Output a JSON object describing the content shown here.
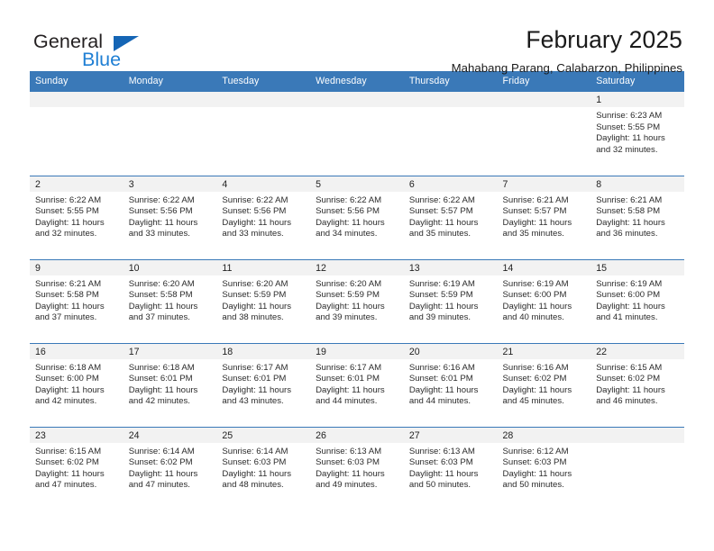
{
  "brand": {
    "name_part1": "General",
    "name_part2": "Blue",
    "triangle_icon": "triangle-icon",
    "color_dark": "#231f20",
    "color_blue": "#1f7fd4"
  },
  "header": {
    "title": "February 2025",
    "subtitle": "Mahabang Parang, Calabarzon, Philippines"
  },
  "theme": {
    "header_bg": "#3a79b8",
    "header_text": "#ffffff",
    "daynum_band_bg": "#f2f2f2",
    "row_divider": "#3a79b8"
  },
  "calendar": {
    "weekdays": [
      "Sunday",
      "Monday",
      "Tuesday",
      "Wednesday",
      "Thursday",
      "Friday",
      "Saturday"
    ],
    "weeks": [
      [
        {
          "day": "",
          "empty": true
        },
        {
          "day": "",
          "empty": true
        },
        {
          "day": "",
          "empty": true
        },
        {
          "day": "",
          "empty": true
        },
        {
          "day": "",
          "empty": true
        },
        {
          "day": "",
          "empty": true
        },
        {
          "day": "1",
          "sunrise": "Sunrise: 6:23 AM",
          "sunset": "Sunset: 5:55 PM",
          "daylight1": "Daylight: 11 hours",
          "daylight2": "and 32 minutes."
        }
      ],
      [
        {
          "day": "2",
          "sunrise": "Sunrise: 6:22 AM",
          "sunset": "Sunset: 5:55 PM",
          "daylight1": "Daylight: 11 hours",
          "daylight2": "and 32 minutes."
        },
        {
          "day": "3",
          "sunrise": "Sunrise: 6:22 AM",
          "sunset": "Sunset: 5:56 PM",
          "daylight1": "Daylight: 11 hours",
          "daylight2": "and 33 minutes."
        },
        {
          "day": "4",
          "sunrise": "Sunrise: 6:22 AM",
          "sunset": "Sunset: 5:56 PM",
          "daylight1": "Daylight: 11 hours",
          "daylight2": "and 33 minutes."
        },
        {
          "day": "5",
          "sunrise": "Sunrise: 6:22 AM",
          "sunset": "Sunset: 5:56 PM",
          "daylight1": "Daylight: 11 hours",
          "daylight2": "and 34 minutes."
        },
        {
          "day": "6",
          "sunrise": "Sunrise: 6:22 AM",
          "sunset": "Sunset: 5:57 PM",
          "daylight1": "Daylight: 11 hours",
          "daylight2": "and 35 minutes."
        },
        {
          "day": "7",
          "sunrise": "Sunrise: 6:21 AM",
          "sunset": "Sunset: 5:57 PM",
          "daylight1": "Daylight: 11 hours",
          "daylight2": "and 35 minutes."
        },
        {
          "day": "8",
          "sunrise": "Sunrise: 6:21 AM",
          "sunset": "Sunset: 5:58 PM",
          "daylight1": "Daylight: 11 hours",
          "daylight2": "and 36 minutes."
        }
      ],
      [
        {
          "day": "9",
          "sunrise": "Sunrise: 6:21 AM",
          "sunset": "Sunset: 5:58 PM",
          "daylight1": "Daylight: 11 hours",
          "daylight2": "and 37 minutes."
        },
        {
          "day": "10",
          "sunrise": "Sunrise: 6:20 AM",
          "sunset": "Sunset: 5:58 PM",
          "daylight1": "Daylight: 11 hours",
          "daylight2": "and 37 minutes."
        },
        {
          "day": "11",
          "sunrise": "Sunrise: 6:20 AM",
          "sunset": "Sunset: 5:59 PM",
          "daylight1": "Daylight: 11 hours",
          "daylight2": "and 38 minutes."
        },
        {
          "day": "12",
          "sunrise": "Sunrise: 6:20 AM",
          "sunset": "Sunset: 5:59 PM",
          "daylight1": "Daylight: 11 hours",
          "daylight2": "and 39 minutes."
        },
        {
          "day": "13",
          "sunrise": "Sunrise: 6:19 AM",
          "sunset": "Sunset: 5:59 PM",
          "daylight1": "Daylight: 11 hours",
          "daylight2": "and 39 minutes."
        },
        {
          "day": "14",
          "sunrise": "Sunrise: 6:19 AM",
          "sunset": "Sunset: 6:00 PM",
          "daylight1": "Daylight: 11 hours",
          "daylight2": "and 40 minutes."
        },
        {
          "day": "15",
          "sunrise": "Sunrise: 6:19 AM",
          "sunset": "Sunset: 6:00 PM",
          "daylight1": "Daylight: 11 hours",
          "daylight2": "and 41 minutes."
        }
      ],
      [
        {
          "day": "16",
          "sunrise": "Sunrise: 6:18 AM",
          "sunset": "Sunset: 6:00 PM",
          "daylight1": "Daylight: 11 hours",
          "daylight2": "and 42 minutes."
        },
        {
          "day": "17",
          "sunrise": "Sunrise: 6:18 AM",
          "sunset": "Sunset: 6:01 PM",
          "daylight1": "Daylight: 11 hours",
          "daylight2": "and 42 minutes."
        },
        {
          "day": "18",
          "sunrise": "Sunrise: 6:17 AM",
          "sunset": "Sunset: 6:01 PM",
          "daylight1": "Daylight: 11 hours",
          "daylight2": "and 43 minutes."
        },
        {
          "day": "19",
          "sunrise": "Sunrise: 6:17 AM",
          "sunset": "Sunset: 6:01 PM",
          "daylight1": "Daylight: 11 hours",
          "daylight2": "and 44 minutes."
        },
        {
          "day": "20",
          "sunrise": "Sunrise: 6:16 AM",
          "sunset": "Sunset: 6:01 PM",
          "daylight1": "Daylight: 11 hours",
          "daylight2": "and 44 minutes."
        },
        {
          "day": "21",
          "sunrise": "Sunrise: 6:16 AM",
          "sunset": "Sunset: 6:02 PM",
          "daylight1": "Daylight: 11 hours",
          "daylight2": "and 45 minutes."
        },
        {
          "day": "22",
          "sunrise": "Sunrise: 6:15 AM",
          "sunset": "Sunset: 6:02 PM",
          "daylight1": "Daylight: 11 hours",
          "daylight2": "and 46 minutes."
        }
      ],
      [
        {
          "day": "23",
          "sunrise": "Sunrise: 6:15 AM",
          "sunset": "Sunset: 6:02 PM",
          "daylight1": "Daylight: 11 hours",
          "daylight2": "and 47 minutes."
        },
        {
          "day": "24",
          "sunrise": "Sunrise: 6:14 AM",
          "sunset": "Sunset: 6:02 PM",
          "daylight1": "Daylight: 11 hours",
          "daylight2": "and 47 minutes."
        },
        {
          "day": "25",
          "sunrise": "Sunrise: 6:14 AM",
          "sunset": "Sunset: 6:03 PM",
          "daylight1": "Daylight: 11 hours",
          "daylight2": "and 48 minutes."
        },
        {
          "day": "26",
          "sunrise": "Sunrise: 6:13 AM",
          "sunset": "Sunset: 6:03 PM",
          "daylight1": "Daylight: 11 hours",
          "daylight2": "and 49 minutes."
        },
        {
          "day": "27",
          "sunrise": "Sunrise: 6:13 AM",
          "sunset": "Sunset: 6:03 PM",
          "daylight1": "Daylight: 11 hours",
          "daylight2": "and 50 minutes."
        },
        {
          "day": "28",
          "sunrise": "Sunrise: 6:12 AM",
          "sunset": "Sunset: 6:03 PM",
          "daylight1": "Daylight: 11 hours",
          "daylight2": "and 50 minutes."
        },
        {
          "day": "",
          "empty": true
        }
      ]
    ]
  }
}
